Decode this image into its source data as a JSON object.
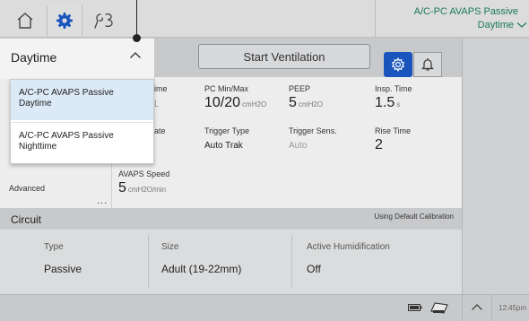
{
  "header": {
    "mode_line1": "A/C-PC AVAPS Passive",
    "mode_line2": "Daytime",
    "tabs": [
      "home-icon",
      "gear-icon",
      "tools-icon"
    ]
  },
  "controls": {
    "start_ventilation": "Start Ventilation"
  },
  "dropdown": {
    "label": "Daytime",
    "options": [
      {
        "line1": "A/C-PC AVAPS Passive",
        "line2": "Daytime"
      },
      {
        "line1": "A/C-PC AVAPS Passive",
        "line2": "Nighttime"
      }
    ]
  },
  "params": {
    "partial_ime_label": "ime",
    "partial_ime_value": "L",
    "pc_minmax_label": "PC Min/Max",
    "pc_minmax_value": "10/20",
    "pc_minmax_unit": "cmH2O",
    "peep_label": "PEEP",
    "peep_value": "5",
    "peep_unit": "cmH2O",
    "insp_time_label": "Insp. Time",
    "insp_time_value": "1.5",
    "insp_time_unit": "s",
    "partial_ate_label": "ate",
    "trigger_type_label": "Trigger Type",
    "trigger_type_value": "Auto Trak",
    "trigger_sens_label": "Trigger Sens.",
    "trigger_sens_value": "Auto",
    "rise_time_label": "Rise Time",
    "rise_time_value": "2",
    "avaps_speed_label": "AVAPS Speed",
    "avaps_speed_value": "5",
    "avaps_speed_unit": "cmH2O/min",
    "advanced_label": "Advanced",
    "advanced_more": "..."
  },
  "circuit": {
    "title": "Circuit",
    "calibration": "Using Default Calibration",
    "type_label": "Type",
    "type_value": "Passive",
    "size_label": "Size",
    "size_value": "Adult (19-22mm)",
    "humid_label": "Active Humidification",
    "humid_value": "Off"
  },
  "status": {
    "time": "12:45pm"
  },
  "colors": {
    "accent": "#1a55bd",
    "mode_text": "#1a7a58"
  }
}
